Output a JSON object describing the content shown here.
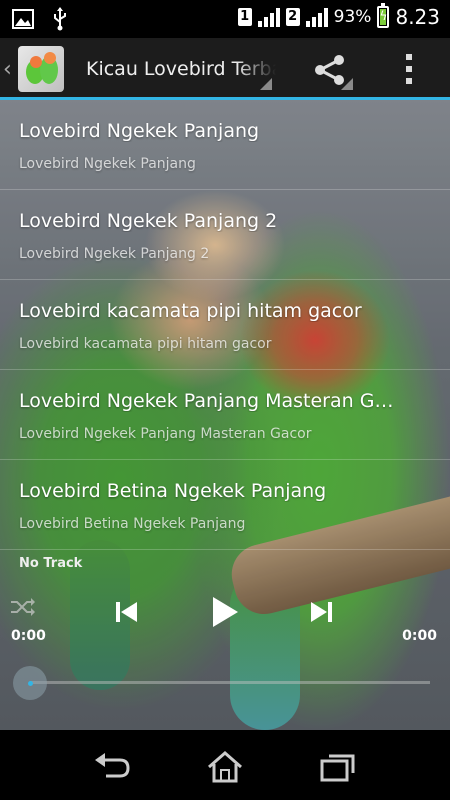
{
  "status_bar": {
    "icons": [
      "gallery-icon",
      "usb-icon"
    ],
    "sim1": "1",
    "sim2": "2",
    "battery": "93%",
    "time": "8.23"
  },
  "action_bar": {
    "title": "Kicau Lovebird Terbaik",
    "icons": [
      "app-icon",
      "share-icon",
      "overflow-menu-icon"
    ]
  },
  "tracks": [
    {
      "title": "Lovebird Ngekek Panjang",
      "subtitle": "Lovebird Ngekek Panjang"
    },
    {
      "title": "Lovebird Ngekek Panjang 2",
      "subtitle": "Lovebird Ngekek Panjang 2"
    },
    {
      "title": "Lovebird kacamata pipi hitam gacor",
      "subtitle": "Lovebird kacamata pipi hitam gacor"
    },
    {
      "title": "Lovebird Ngekek Panjang Masteran Gacor",
      "subtitle": "Lovebird Ngekek Panjang Masteran Gacor"
    },
    {
      "title": "Lovebird Betina Ngekek Panjang",
      "subtitle": "Lovebird Betina Ngekek Panjang"
    }
  ],
  "player": {
    "now_playing": "No Track",
    "elapsed": "0:00",
    "duration": "0:00",
    "progress": 0,
    "icons": [
      "shuffle-icon",
      "previous-icon",
      "play-icon",
      "next-icon"
    ]
  },
  "nav_bar": {
    "icons": [
      "back-icon",
      "home-icon",
      "recents-icon"
    ]
  },
  "colors": {
    "accent": "#33b5e5",
    "action_bar": "#1c1c1c"
  }
}
